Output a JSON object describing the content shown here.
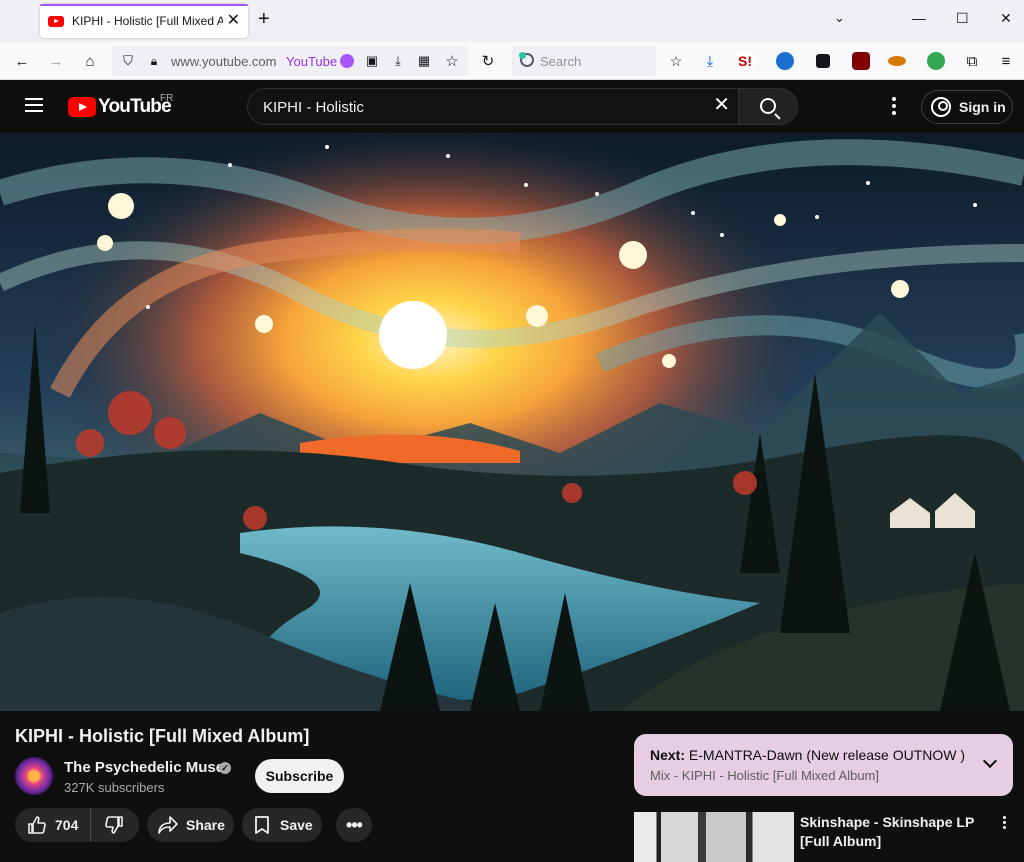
{
  "browser": {
    "tab_title": "KIPHI - Holistic [Full Mixed Album]",
    "url_text": "www.youtube.com",
    "url_tag": "YouTube",
    "search_placeholder": "Search"
  },
  "youtube": {
    "logo_text": "YouTube",
    "country_code": "FR",
    "search_query": "KIPHI - Holistic",
    "sign_in_label": "Sign in"
  },
  "video": {
    "title": "KIPHI - Holistic [Full Mixed Album]",
    "channel_name": "The Psychedelic Muse",
    "subscribers": "327K subscribers",
    "subscribe_label": "Subscribe",
    "like_count": "704",
    "share_label": "Share",
    "save_label": "Save"
  },
  "up_next": {
    "label": "Next:",
    "title": "E-MANTRA-Dawn (New release OUTNOW )",
    "mix": "Mix - KIPHI - Holistic [Full Mixed Album]"
  },
  "recommendations": [
    {
      "title": "Skinshape - Skinshape LP [Full Album]"
    }
  ],
  "colors": {
    "accent_purple": "#a855f7",
    "youtube_red": "#ff0000",
    "page_bg": "#0f0f0f",
    "next_card_bg": "#e6cde3"
  }
}
